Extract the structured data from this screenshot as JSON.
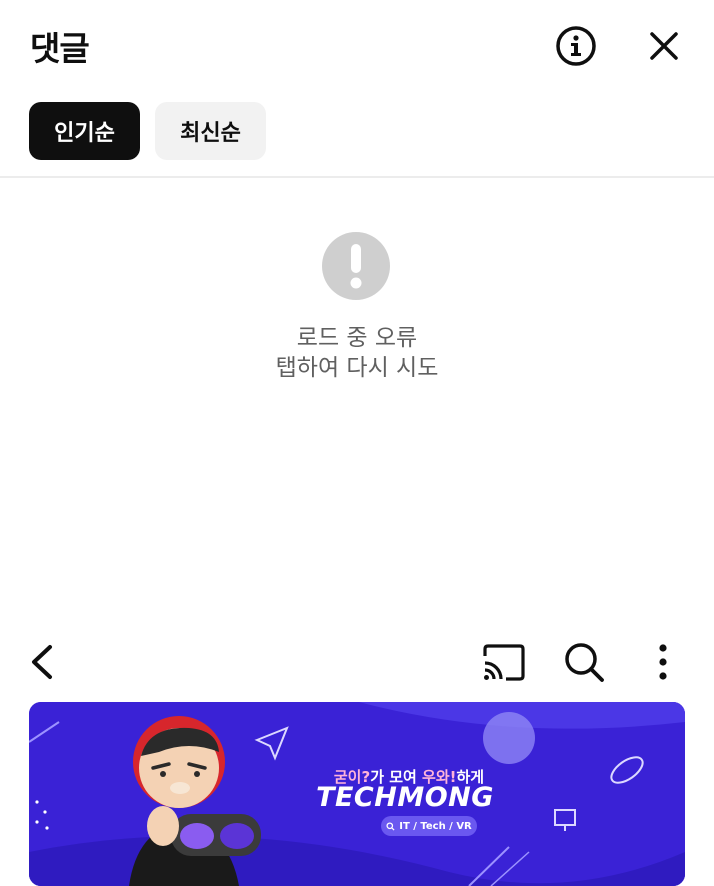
{
  "header": {
    "title": "댓글",
    "info_icon": "info-circle-icon",
    "close_icon": "close-icon"
  },
  "sort_chips": [
    {
      "label": "인기순",
      "active": true
    },
    {
      "label": "최신순",
      "active": false
    }
  ],
  "error": {
    "icon": "exclamation-circle-icon",
    "line1": "로드 중 오류",
    "line2": "탭하여 다시 시도"
  },
  "player_bar": {
    "back_icon": "chevron-left-icon",
    "cast_icon": "cast-icon",
    "search_icon": "search-icon",
    "more_icon": "more-vertical-icon"
  },
  "banner": {
    "tagline_part1": "굳이?",
    "tagline_part2": "가 모여 ",
    "tagline_part3": "우와!",
    "tagline_part4": "하게",
    "brand": "TECHMONG",
    "pill_text": "IT / Tech / VR",
    "colors": {
      "background": "#3a22d6",
      "highlight": "#ffb3d9",
      "pill": "#6a58f0"
    }
  }
}
